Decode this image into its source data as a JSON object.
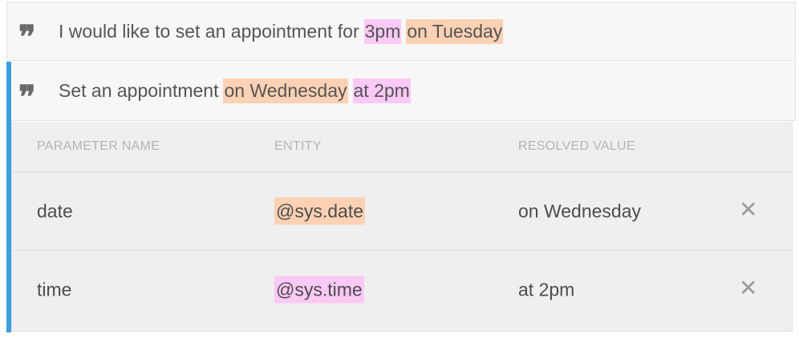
{
  "phrases": [
    {
      "icon": "quote-icon",
      "prefix": "I would like to set an appointment for",
      "seg1": "3pm",
      "seg2": "on Tuesday"
    },
    {
      "icon": "quote-icon",
      "prefix": "Set an appointment",
      "seg1": "on Wednesday",
      "seg2": "at 2pm"
    }
  ],
  "table": {
    "headers": [
      "PARAMETER NAME",
      "ENTITY",
      "RESOLVED VALUE"
    ],
    "rows": [
      {
        "name": "date",
        "entity": "@sys.date",
        "value": "on Wednesday",
        "delete_icon": "close-icon"
      },
      {
        "name": "time",
        "entity": "@sys.time",
        "value": "at 2pm",
        "delete_icon": "close-icon"
      }
    ]
  },
  "colors": {
    "active_bar": "#3aa0dc",
    "time_highlight": "#fbc9f6",
    "date_highlight": "#fdd1b3"
  }
}
